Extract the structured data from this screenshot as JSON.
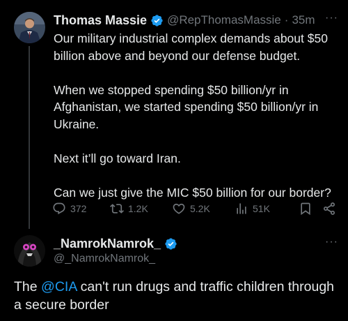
{
  "tweet1": {
    "author_name": "Thomas Massie",
    "handle": "@RepThomasMassie",
    "separator": "·",
    "time": "35m",
    "more": "···",
    "paragraphs": [
      "Our military industrial complex demands about $50 billion above and beyond our defense budget.",
      "When we stopped spending $50 billion/yr in Afghanistan, we started spending $50 billion/yr in Ukraine.",
      "Next it’ll go toward Iran.",
      "Can we just give the MIC $50 billion for our border?"
    ],
    "stats": {
      "replies": "372",
      "retweets": "1.2K",
      "likes": "5.2K",
      "views": "51K"
    }
  },
  "tweet2": {
    "author_name": "_NamrokNamrok_",
    "handle": "@_NamrokNamrok_",
    "more": "···",
    "text_before": "The ",
    "mention": "@CIA",
    "text_after": " can't run drugs and traffic children through a secure border"
  },
  "colors": {
    "background": "#000000",
    "text": "#e7e9ea",
    "muted": "#71767b",
    "accent": "#1d9bf0",
    "verified": "#1d9bf0"
  },
  "icons": [
    "verified-badge-icon",
    "reply-icon",
    "retweet-icon",
    "like-icon",
    "views-icon",
    "bookmark-icon",
    "share-icon",
    "more-icon"
  ]
}
